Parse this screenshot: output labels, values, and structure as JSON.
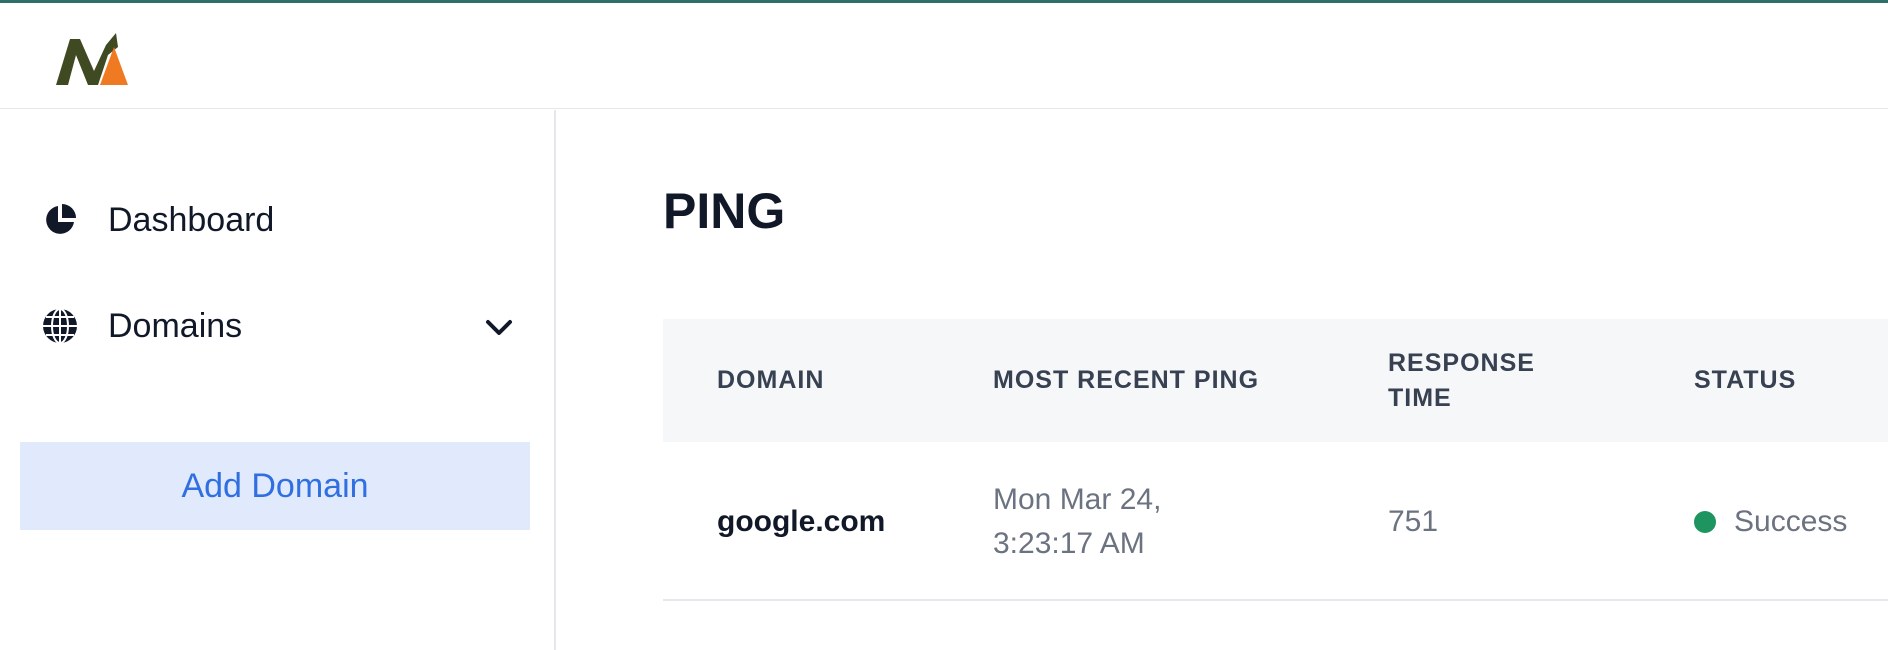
{
  "header": {
    "logo_colors": {
      "primary": "#3f4a22",
      "accent": "#f07a22"
    }
  },
  "sidebar": {
    "items": [
      {
        "label": "Dashboard",
        "icon": "pie-chart-icon"
      },
      {
        "label": "Domains",
        "icon": "globe-icon",
        "expandable": true
      }
    ],
    "add_domain_label": "Add Domain"
  },
  "main": {
    "title": "PING",
    "table": {
      "columns": [
        "DOMAIN",
        "MOST RECENT PING",
        "RESPONSE TIME",
        "STATUS"
      ],
      "rows": [
        {
          "domain": "google.com",
          "most_recent_ping_line1": "Mon Mar 24,",
          "most_recent_ping_line2": "3:23:17 AM",
          "response_time": "751",
          "status": "Success",
          "status_color": "#1e9461"
        }
      ]
    }
  },
  "colors": {
    "accent_bar": "#2f6f6a",
    "add_button_bg": "#e1e9fc",
    "add_button_text": "#2f6fe0",
    "table_header_bg": "#f6f7f9"
  }
}
